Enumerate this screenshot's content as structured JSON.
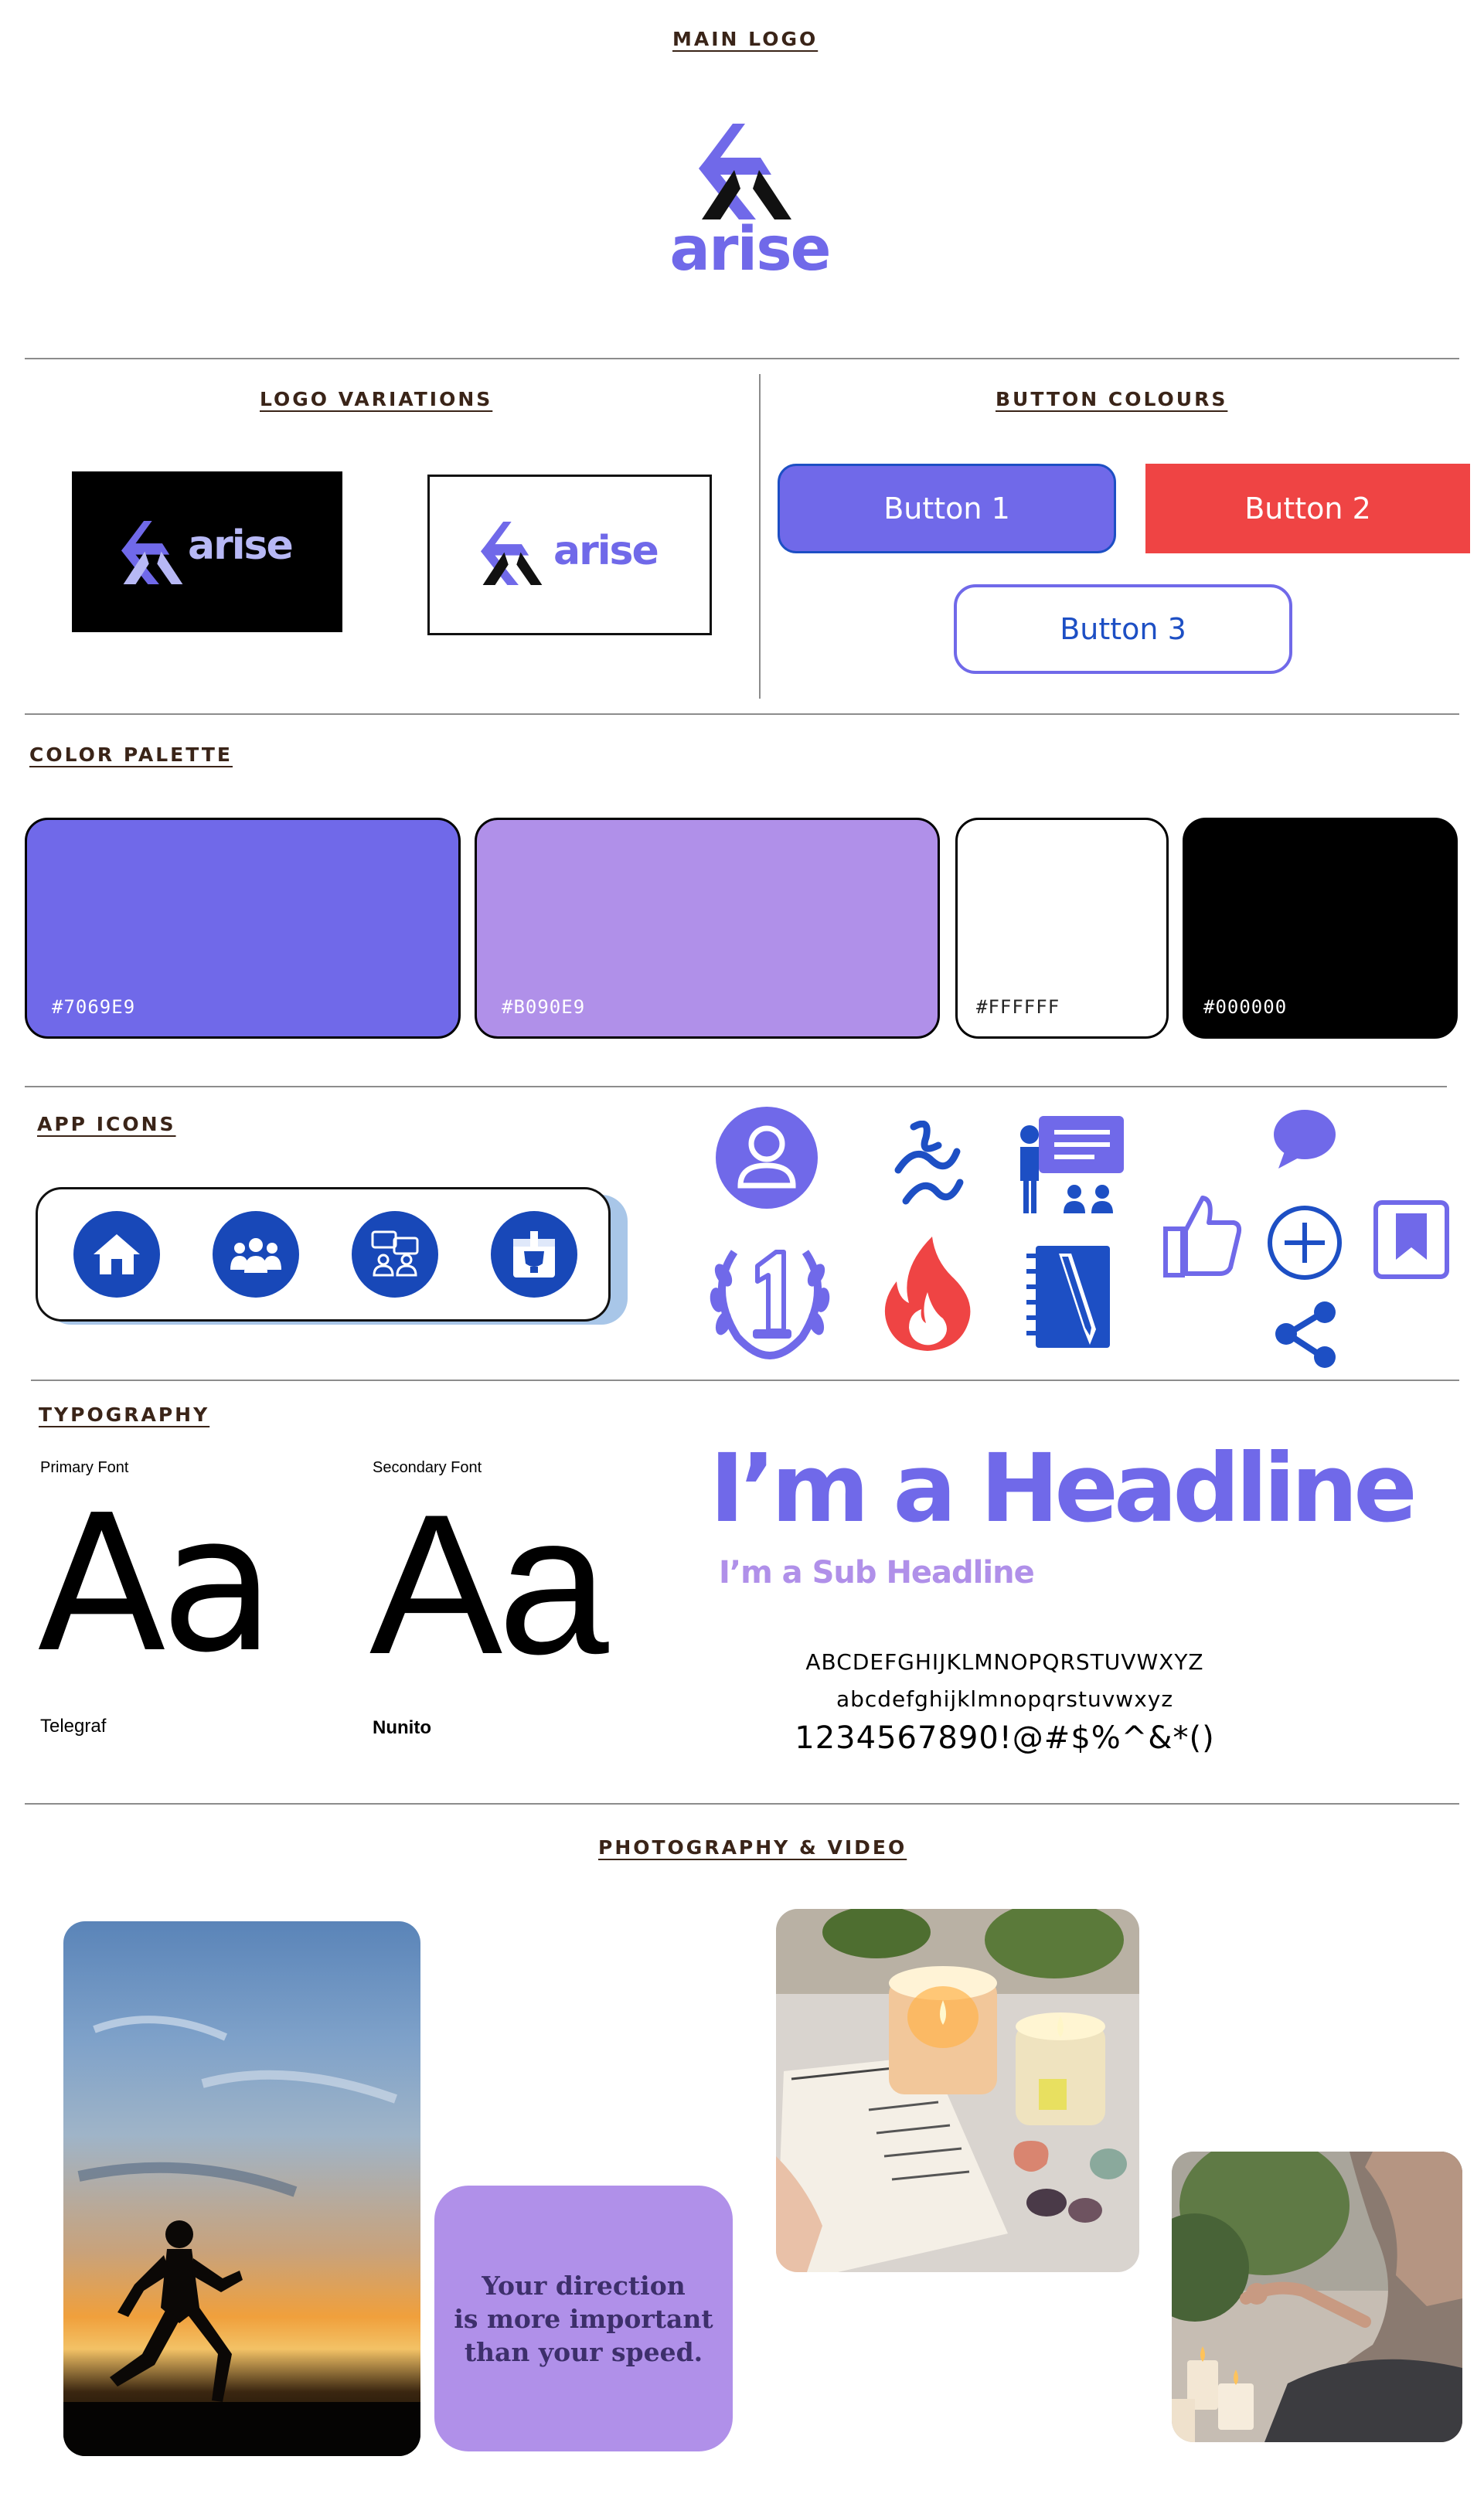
{
  "sections": {
    "main_logo": "MAIN LOGO",
    "logo_variations": "LOGO VARIATIONS",
    "button_colours": "BUTTON COLOURS",
    "color_palette": "COLOR PALETTE",
    "app_icons": "APP ICONS",
    "typography": "TYPOGRAPHY",
    "photography": "PHOTOGRAPHY & VIDEO"
  },
  "brand": {
    "name": "arise"
  },
  "buttons": [
    {
      "label": "Button 1",
      "bg": "#7069E9",
      "text_color": "#ffffff"
    },
    {
      "label": "Button 2",
      "bg": "#EF4444",
      "text_color": "#ffffff"
    },
    {
      "label": "Button 3",
      "bg": "#ffffff",
      "text_color": "#1d4fc4"
    }
  ],
  "palette": [
    {
      "hex_label": "#7069E9",
      "color": "#7069E9"
    },
    {
      "hex_label": "#B090E9",
      "color": "#B090E9"
    },
    {
      "hex_label": "#FFFFFF",
      "color": "#FFFFFF"
    },
    {
      "hex_label": "#000000",
      "color": "#000000"
    }
  ],
  "app_icons": {
    "bar_icons": [
      "home-icon",
      "group-icon",
      "meeting-icon",
      "trophy-icon"
    ],
    "grid_icons": [
      "user-profile-icon",
      "squiggle-icon",
      "presentation-icon",
      "chat-bubble-icon",
      "thumbs-up-icon",
      "plus-circle-icon",
      "bookmark-icon",
      "first-place-laurel-icon",
      "fire-icon",
      "notebook-pen-icon",
      "share-icon"
    ],
    "colors": {
      "purple": "#7069E9",
      "blue": "#1848b8",
      "red": "#EF4444"
    }
  },
  "typography": {
    "primary_label": "Primary Font",
    "secondary_label": "Secondary Font",
    "sample": "Aa",
    "primary_name": "Telegraf",
    "secondary_name": "Nunito",
    "headline": "I’m a Headline",
    "subheadline": "I’m a Sub Headline",
    "uppercase": "ABCDEFGHIJKLMNOPQRSTUVWXYZ",
    "lowercase": "abcdefghijklmnopqrstuvwxyz",
    "numbers": "1234567890!@#$%^&*()"
  },
  "photography": {
    "quote_lines": [
      "Your direction",
      "is more important",
      "than your speed."
    ],
    "quote_bg": "#B090E9"
  }
}
